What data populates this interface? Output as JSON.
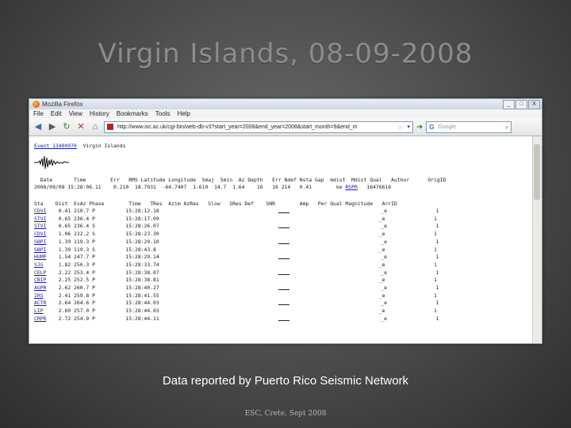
{
  "slide": {
    "title": "Virgin Islands, 08-09-2008",
    "caption": "Data reported by Puerto Rico Seismic Network",
    "footer": "ESC, Crete, Sept 2008"
  },
  "browser": {
    "window_title": "Mozilla Firefox",
    "menu": [
      "File",
      "Edit",
      "View",
      "History",
      "Bookmarks",
      "Tools",
      "Help"
    ],
    "url": "http://www.isc.ac.uk/cgi-bin/web-db-v3?start_year=2008&end_year=2008&start_month=9&end_m",
    "search_placeholder": "Google",
    "window_buttons": [
      "_",
      "□",
      "X"
    ]
  },
  "page": {
    "event_link": "Event 13400070",
    "event_region": "Virgin Islands",
    "origin_header": "  Date       Time        Err   RMS Latitude Longitude  Smaj  Smin  Az Depth   Err Ndef Nsta Gap  mdist  Mdist Qual   Author      OrigID",
    "origin_date_time": "2008/09/08 15:28:06.11    0.210  18.7931  -64.7407  1.619",
    "origin_rest": "  14.7  1.64    16   16 214   0.41        ke ",
    "origin_author": "RSPR",
    "origin_id": "   16476616",
    "table_header": "Sta    Dist  EvAz Phase        Time   TRes  Azim AzRes   Slow   SRes Def    SNR        Amp   Per Qual Magnitude   ArrID",
    "arrivals": [
      {
        "sta": "CDVI",
        "dist": "0.41",
        "evaz": "210.7",
        "phase": "P",
        "time": "15:28:12.18",
        "qual": "_e"
      },
      {
        "sta": "STVI",
        "dist": "0.65",
        "evaz": "236.4",
        "phase": "P",
        "time": "15:28:17.09",
        "qual": "_e"
      },
      {
        "sta": "STVI",
        "dist": "0.65",
        "evaz": "236.4",
        "phase": "S",
        "time": "15:28:26.07",
        "qual": "_e"
      },
      {
        "sta": "CDVI",
        "dist": "1.06",
        "evaz": "232.2",
        "phase": "S",
        "time": "15:28:23.30",
        "qual": "_e"
      },
      {
        "sta": "SBPI",
        "dist": "1.39",
        "evaz": "119.3",
        "phase": "P",
        "time": "15:28:29.10",
        "qual": "_e"
      },
      {
        "sta": "SBPI",
        "dist": "1.39",
        "evaz": "119.3",
        "phase": "S",
        "time": "15:28:43.8",
        "qual": "_e"
      },
      {
        "sta": "HUMP",
        "dist": "1.54",
        "evaz": "247.7",
        "phase": "P",
        "time": "15:28:29.14",
        "qual": "_e"
      },
      {
        "sta": "SJG",
        "dist": "1.82",
        "evaz": "250.3",
        "phase": "P",
        "time": "15:28:33.74",
        "qual": "_e"
      },
      {
        "sta": "CELP",
        "dist": "2.22",
        "evaz": "253.4",
        "phase": "P",
        "time": "15:28:38.07",
        "qual": "_e"
      },
      {
        "sta": "CBIP",
        "dist": "2.25",
        "evaz": "252.5",
        "phase": "P",
        "time": "15:28:38.81",
        "qual": "_e"
      },
      {
        "sta": "AGPR",
        "dist": "2.62",
        "evaz": "260.7",
        "phase": "P",
        "time": "15:28:40.27",
        "qual": "_e"
      },
      {
        "sta": "IRS",
        "dist": "2.41",
        "evaz": "259.8",
        "phase": "P",
        "time": "15:28:41.55",
        "qual": "_e"
      },
      {
        "sta": "ACTR",
        "dist": "2.64",
        "evaz": "264.6",
        "phase": "P",
        "time": "15:28:44.03",
        "qual": "_e"
      },
      {
        "sta": "LIP",
        "dist": "2.60",
        "evaz": "257.0",
        "phase": "P",
        "time": "15:28:44.03",
        "qual": "_e"
      },
      {
        "sta": "CRPR",
        "dist": "2.72",
        "evaz": "254.9",
        "phase": "P",
        "time": "15:28:44.11",
        "qual": "_e"
      }
    ],
    "arr_id": "1"
  }
}
